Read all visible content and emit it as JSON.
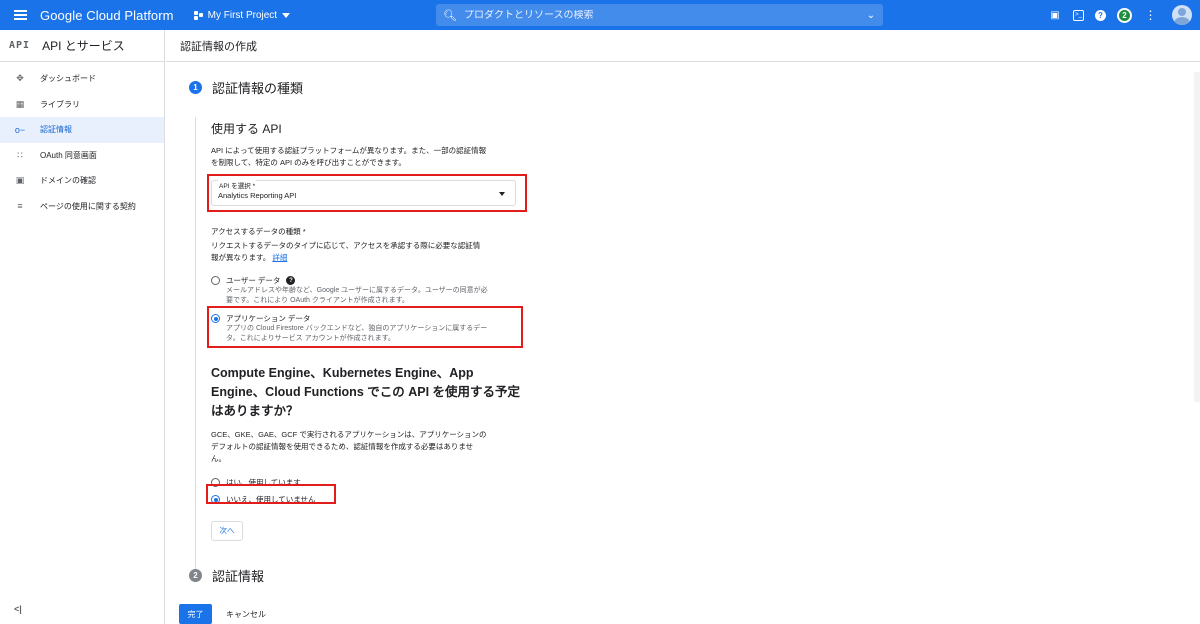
{
  "topbar": {
    "brand": "Google Cloud Platform",
    "project": "My First Project",
    "search_placeholder": "プロダクトとリソースの検索",
    "notification_count": "2"
  },
  "sidebar": {
    "logo": "API",
    "title": "API とサービス",
    "items": [
      {
        "label": "ダッシュボード",
        "icon": "dashboard-icon"
      },
      {
        "label": "ライブラリ",
        "icon": "library-icon"
      },
      {
        "label": "認証情報",
        "icon": "key-icon",
        "active": true
      },
      {
        "label": "OAuth 同意画面",
        "icon": "oauth-icon"
      },
      {
        "label": "ドメインの確認",
        "icon": "domain-icon"
      },
      {
        "label": "ページの使用に関する契約",
        "icon": "settings-icon"
      }
    ],
    "collapse": "<|"
  },
  "page": {
    "title": "認証情報の作成"
  },
  "step1": {
    "number": "1",
    "title": "認証情報の種類"
  },
  "api_section": {
    "title": "使用する API",
    "desc_line1": "API によって使用する認証プラットフォームが異なります。また、一部の認証情報",
    "desc_line2": "を制限して、特定の API のみを呼び出すことができます。",
    "select_label": "API を選択 *",
    "select_value": "Analytics Reporting API"
  },
  "access_section": {
    "label": "アクセスするデータの種類 *",
    "desc_line1": "リクエストするデータのタイプに応じて、アクセスを承認する際に必要な認証情",
    "desc_line2": "報が異なります。",
    "link": "詳細",
    "options": [
      {
        "title": "ユーザー データ",
        "desc_line1": "メールアドレスや年齢など、Google ユーザーに属するデータ。ユーザーの同意が必",
        "desc_line2": "要です。これにより OAuth クライアントが作成されます。",
        "selected": false
      },
      {
        "title": "アプリケーション データ",
        "desc_line1": "アプリの Cloud Firestore バックエンドなど、独自のアプリケーションに属するデー",
        "desc_line2": "タ。これによりサービス アカウントが作成されます。",
        "selected": true
      }
    ]
  },
  "compute_section": {
    "title_line1": "Compute Engine、Kubernetes Engine、App",
    "title_line2": "Engine、Cloud Functions でこの API を使用する予定",
    "title_line3": "はありますか？",
    "desc_line1": "GCE、GKE、GAE、GCF で実行されるアプリケーションは、アプリケーションの",
    "desc_line2": "デフォルトの認証情報を使用できるため、認証情報を作成する必要はありませ",
    "desc_line3": "ん。",
    "options": [
      {
        "title": "はい、使用しています",
        "selected": false
      },
      {
        "title": "いいえ、使用していません",
        "selected": true
      }
    ],
    "next": "次へ"
  },
  "step2": {
    "number": "2",
    "title": "認証情報"
  },
  "actions": {
    "done": "完了",
    "cancel": "キャンセル"
  },
  "colors": {
    "accent": "#1a73e8",
    "highlight": "#e21b1b"
  }
}
